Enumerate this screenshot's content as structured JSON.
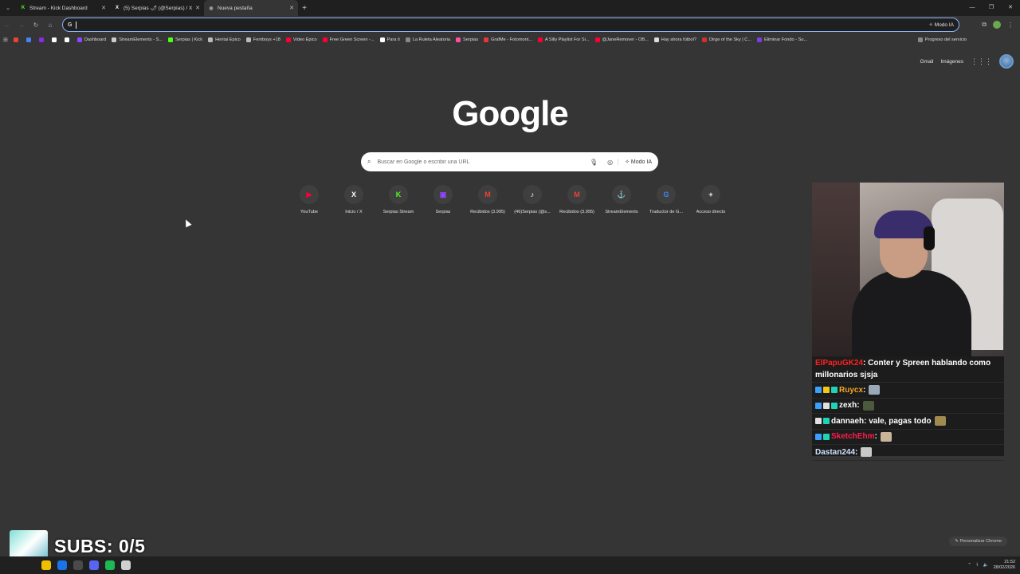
{
  "tabs": [
    {
      "title": "Stream - Kick Dashboard",
      "icon": "kick-icon",
      "color": "#53fc18",
      "glyph": "K"
    },
    {
      "title": "(5) Serpias 🌶 (@Serpias) / X",
      "icon": "x-icon",
      "color": "#ffffff",
      "glyph": "X"
    },
    {
      "title": "Nueva pestaña",
      "icon": "chrome-icon",
      "color": "#9aa0a6",
      "glyph": "◉"
    }
  ],
  "omnibox": {
    "placeholder": "",
    "ai_label": "Modo IA"
  },
  "bookmarks": [
    {
      "label": "",
      "color": "#ea4335"
    },
    {
      "label": "",
      "color": "#4285f4"
    },
    {
      "label": "",
      "color": "#8a2be2"
    },
    {
      "label": "",
      "color": "#ffffff"
    },
    {
      "label": "",
      "color": "#ffffff"
    },
    {
      "label": "Dashboard",
      "color": "#9146ff"
    },
    {
      "label": "StreamElements - S...",
      "color": "#cccccc"
    },
    {
      "label": "Serpias | Kick",
      "color": "#53fc18"
    },
    {
      "label": "Hentai Epico",
      "color": "#bbbbbb"
    },
    {
      "label": "Femboys +18",
      "color": "#bbbbbb"
    },
    {
      "label": "Video Epico",
      "color": "#ff0033"
    },
    {
      "label": "Free Green Screen -...",
      "color": "#ff0033"
    },
    {
      "label": "Para ti",
      "color": "#ffffff"
    },
    {
      "label": "La Ruleta Aleatoria",
      "color": "#888888"
    },
    {
      "label": "Serpias",
      "color": "#ff4fa3"
    },
    {
      "label": "GrafMe - Fotomont...",
      "color": "#e53935"
    },
    {
      "label": "A Silly Playlist For Si...",
      "color": "#ff0033"
    },
    {
      "label": "@JaneRemover - OB...",
      "color": "#ff0033"
    },
    {
      "label": "Hay ahora fútbol?",
      "color": "#dddddd"
    },
    {
      "label": "Dirge of the Sky | C...",
      "color": "#d32f2f"
    },
    {
      "label": "Eliminar Fondo - Su...",
      "color": "#7b3fe4"
    },
    {
      "label": "Progreso del servicio",
      "color": "#888888"
    }
  ],
  "google_links": {
    "gmail": "Gmail",
    "images": "Imágenes"
  },
  "logo": "Google",
  "search": {
    "placeholder": "Buscar en Google o escribir una URL",
    "ai_label": "Modo IA"
  },
  "shortcuts": [
    {
      "label": "YouTube",
      "glyph": "▶",
      "color": "#ff0033"
    },
    {
      "label": "Inicio / X",
      "glyph": "X",
      "color": "#ffffff"
    },
    {
      "label": "Serpias Stream",
      "glyph": "K",
      "color": "#53fc18"
    },
    {
      "label": "Serpias",
      "glyph": "▣",
      "color": "#9146ff"
    },
    {
      "label": "Recibidos (3.995)",
      "glyph": "M",
      "color": "#ea4335"
    },
    {
      "label": "(46)Serpias (@s...",
      "glyph": "♪",
      "color": "#ffffff"
    },
    {
      "label": "Recibidos (3.995)",
      "glyph": "M",
      "color": "#ea4335"
    },
    {
      "label": "StreamElements",
      "glyph": "⚓",
      "color": "#ffffff"
    },
    {
      "label": "Traductor de G...",
      "glyph": "G",
      "color": "#4285f4"
    },
    {
      "label": "Acceso directo",
      "glyph": "+",
      "color": "#ffffff"
    }
  ],
  "chat": [
    {
      "user": "ElPapuGK24",
      "user_color": "#ff2020",
      "text": ": Conter y Spreen hablando como millonarios sjsja",
      "badges": []
    },
    {
      "user": "Ruycx",
      "user_color": "#f5a623",
      "text": " :",
      "badges": [
        "#3aa0ff",
        "#f5c518",
        "#1ed3b6"
      ],
      "emote": "#9aa9b8"
    },
    {
      "user": "zexh",
      "user_color": "#ffffff",
      "text": " :",
      "badges": [
        "#3aa0ff",
        "#e0e0e0",
        "#1ed3b6"
      ],
      "emote": "#4b5a3a"
    },
    {
      "user": "dannaeh",
      "user_color": "#ffffff",
      "text": " : vale, pagas todo",
      "badges": [
        "#e0e0e0",
        "#1ed3b6"
      ],
      "emote": "#a08a50"
    },
    {
      "user": "SketchEhm",
      "user_color": "#ff1f4b",
      "text": " :",
      "badges": [
        "#3aa0ff",
        "#1ed3b6"
      ],
      "emote": "#c9b49a"
    },
    {
      "user": "Dastan244",
      "user_color": "#cfe3ff",
      "text": " :",
      "badges": [],
      "emote": "#c9c9c9"
    }
  ],
  "subs": {
    "text": "SUBS: 0/5"
  },
  "customize": {
    "label": "Personalizar Chrome"
  },
  "clock": {
    "time": "21:52",
    "date": "28/02/2026"
  },
  "taskbar_icons": [
    "#f0c000",
    "#1a73e8",
    "#4a4a4a",
    "#5865f2",
    "#1db954",
    "#d0d0d0"
  ]
}
